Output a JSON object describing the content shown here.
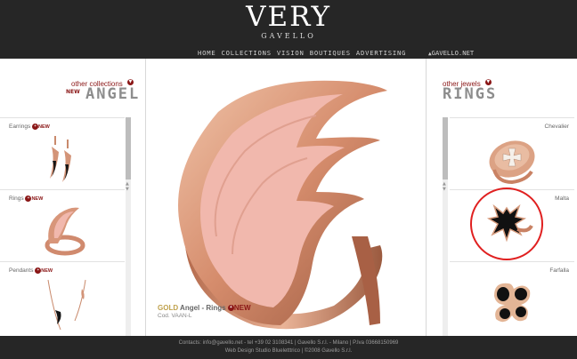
{
  "header": {
    "logo": "VERY",
    "logo_sub": "GAVELLO",
    "nav": [
      "HOME",
      "COLLECTIONS",
      "VISION",
      "BOUTIQUES",
      "ADVERTISING"
    ],
    "site_link": "GAVELLO.NET"
  },
  "left": {
    "other_link": "other collections",
    "new_tag": "NEW",
    "title": "ANGEL",
    "items": [
      {
        "label": "Earrings",
        "new": "NEW"
      },
      {
        "label": "Rings",
        "new": "NEW"
      },
      {
        "label": "Pendants",
        "new": "NEW"
      }
    ]
  },
  "main": {
    "metal": "GOLD",
    "product": "Angel - Rings",
    "new": "NEW",
    "code": "Cod. VAAN-L"
  },
  "right": {
    "other_link": "other jewels",
    "title": "RINGS",
    "items": [
      {
        "label": "Chevalier"
      },
      {
        "label": "Malta"
      },
      {
        "label": "Farfalla"
      }
    ]
  },
  "footer": {
    "line1": "Contacts: info@gavello.net - tel +39 02 3108341 | Gavello S.r.l. - Milano | P.Iva 03668150969",
    "line2": "Web Design Studio Blueletttrico | ©2008 Gavello S.r.l."
  },
  "colors": {
    "accent": "#8a1616",
    "header_bg": "#262626",
    "gold": "#bfa14c",
    "rose_gold": "#d8967a",
    "enamel_pink": "#f1b8ad"
  }
}
